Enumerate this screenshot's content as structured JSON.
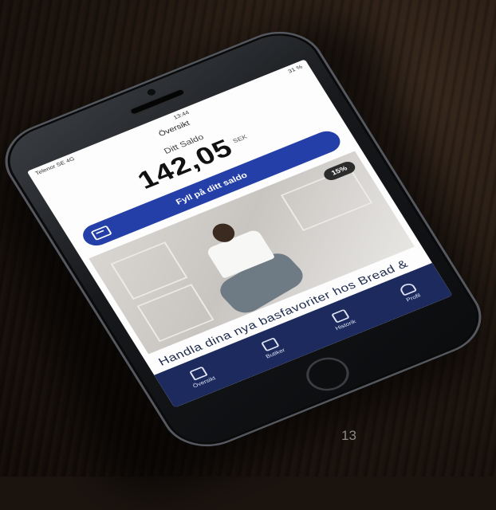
{
  "status_bar": {
    "carrier": "Telenor SE 4G",
    "time": "13:44",
    "battery": "31 %"
  },
  "screen": {
    "title": "Översikt"
  },
  "balance": {
    "label": "Ditt Saldo",
    "value": "142,05",
    "currency": "SEK"
  },
  "topup_button": {
    "label": "Fyll på ditt saldo",
    "icon": "wallet-icon"
  },
  "promo": {
    "discount": "15%",
    "headline": "Handla dina nya basfavoriter hos Bread & Boxers"
  },
  "tabbar": {
    "items": [
      {
        "label": "Översikt",
        "icon": "home-icon"
      },
      {
        "label": "Butiker",
        "icon": "store-icon"
      },
      {
        "label": "Historik",
        "icon": "history-icon"
      },
      {
        "label": "Profil",
        "icon": "profile-icon"
      }
    ]
  },
  "page_number": "13",
  "colors": {
    "accent": "#2440a8",
    "tabbar": "#1c2a5e"
  }
}
